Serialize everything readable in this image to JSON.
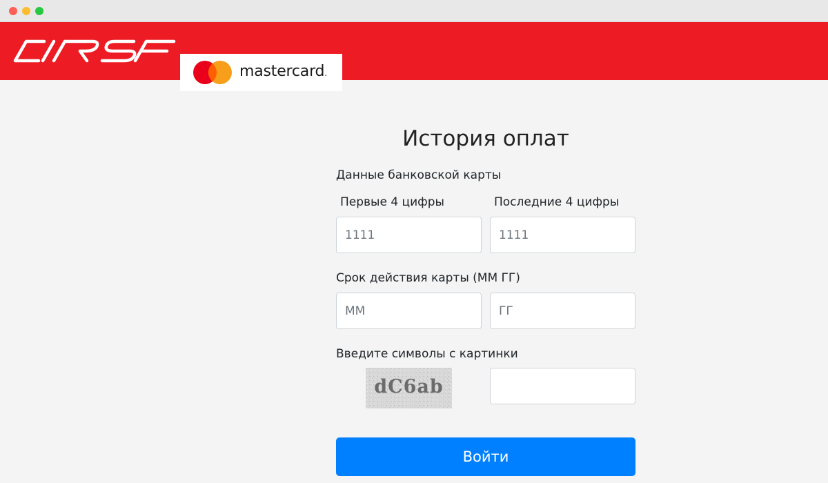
{
  "banner": {
    "brand_logo_icon": "clrs-logo",
    "partner_logo_icon": "mastercard-logo",
    "partner_wordmark": "mastercard",
    "partner_wordmark_suffix": ".",
    "colors": {
      "banner": "#ed1c24",
      "mc_red": "#eb001b",
      "mc_orange": "#f79e1b"
    }
  },
  "form": {
    "title": "История оплат",
    "card_section_label": "Данные банковской карты",
    "first4": {
      "label": "Первые 4 цифры",
      "placeholder": "1111"
    },
    "last4": {
      "label": "Последние 4 цифры",
      "placeholder": "1111"
    },
    "expiry_label": "Срок действия карты (ММ ГГ)",
    "month": {
      "placeholder": "ММ"
    },
    "year": {
      "placeholder": "ГГ"
    },
    "captcha_label": "Введите символы с картинки",
    "captcha_text": "dC6ab",
    "captcha_input": {
      "value": ""
    },
    "submit_label": "Войти",
    "colors": {
      "submit": "#0080ff"
    }
  }
}
